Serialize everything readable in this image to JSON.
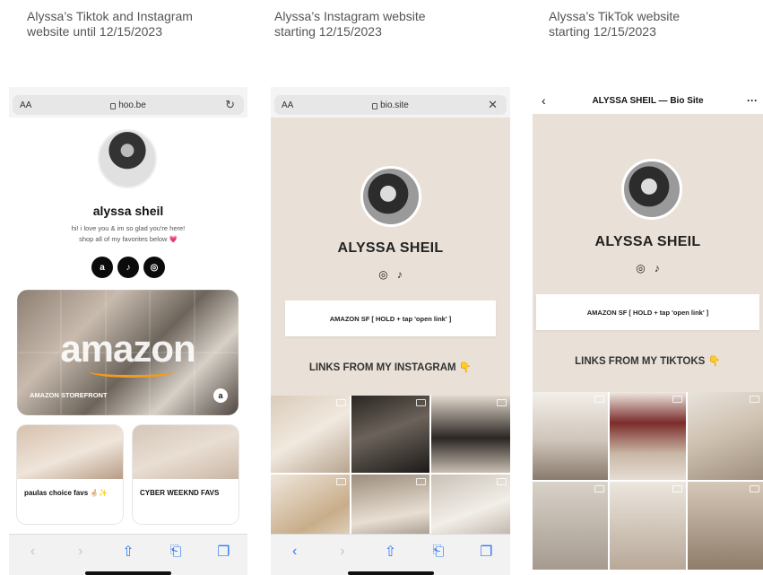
{
  "captions": [
    "Alyssa’s Tiktok and Instagram\nwebsite until 12/15/2023",
    "Alyssa’s Instagram website\nstarting 12/15/2023",
    "Alyssa’s TikTok website\nstarting 12/15/2023"
  ],
  "phone1": {
    "text_size": "AA",
    "url": "hoo.be",
    "reload_icon": "reload-icon",
    "name": "alyssa sheil",
    "bio_line1": "hi! i love you & im so glad you're here!",
    "bio_line2": "shop all of my favorites below",
    "bio_emoji": "💗",
    "socials": [
      "a",
      "♪",
      "◎"
    ],
    "storefront_logo": "amazon",
    "storefront_label": "AMAZON STOREFRONT",
    "storefront_badge": "a",
    "cards": [
      {
        "label": "paulas choice favs 🤞🏻✨"
      },
      {
        "label": "CYBER WEEKND FAVS"
      }
    ]
  },
  "phone2": {
    "text_size": "AA",
    "url": "bio.site",
    "close_icon": "✕",
    "title": "ALYSSA SHEIL",
    "pill": "AMAZON SF [ HOLD + tap 'open link' ]",
    "links_heading": "LINKS FROM MY INSTAGRAM",
    "hand": "👇"
  },
  "phone3": {
    "header": "ALYSSA SHEIL — Bio Site",
    "back": "‹",
    "more": "···",
    "title": "ALYSSA SHEIL",
    "pill": "AMAZON SF [ HOLD + tap 'open link' ]",
    "links_heading": "LINKS FROM MY TIKTOKS",
    "hand": "👇"
  },
  "toolbar": {
    "back": "‹",
    "forward": "›",
    "share": "⇧",
    "bookmarks": "⎗",
    "tabs": "❐"
  },
  "colors": {
    "accent_blue": "#2f7cf6",
    "beige": "#e9e1d7",
    "amazon_orange": "#f49a1e",
    "heart_pink": "#d84fb0"
  }
}
